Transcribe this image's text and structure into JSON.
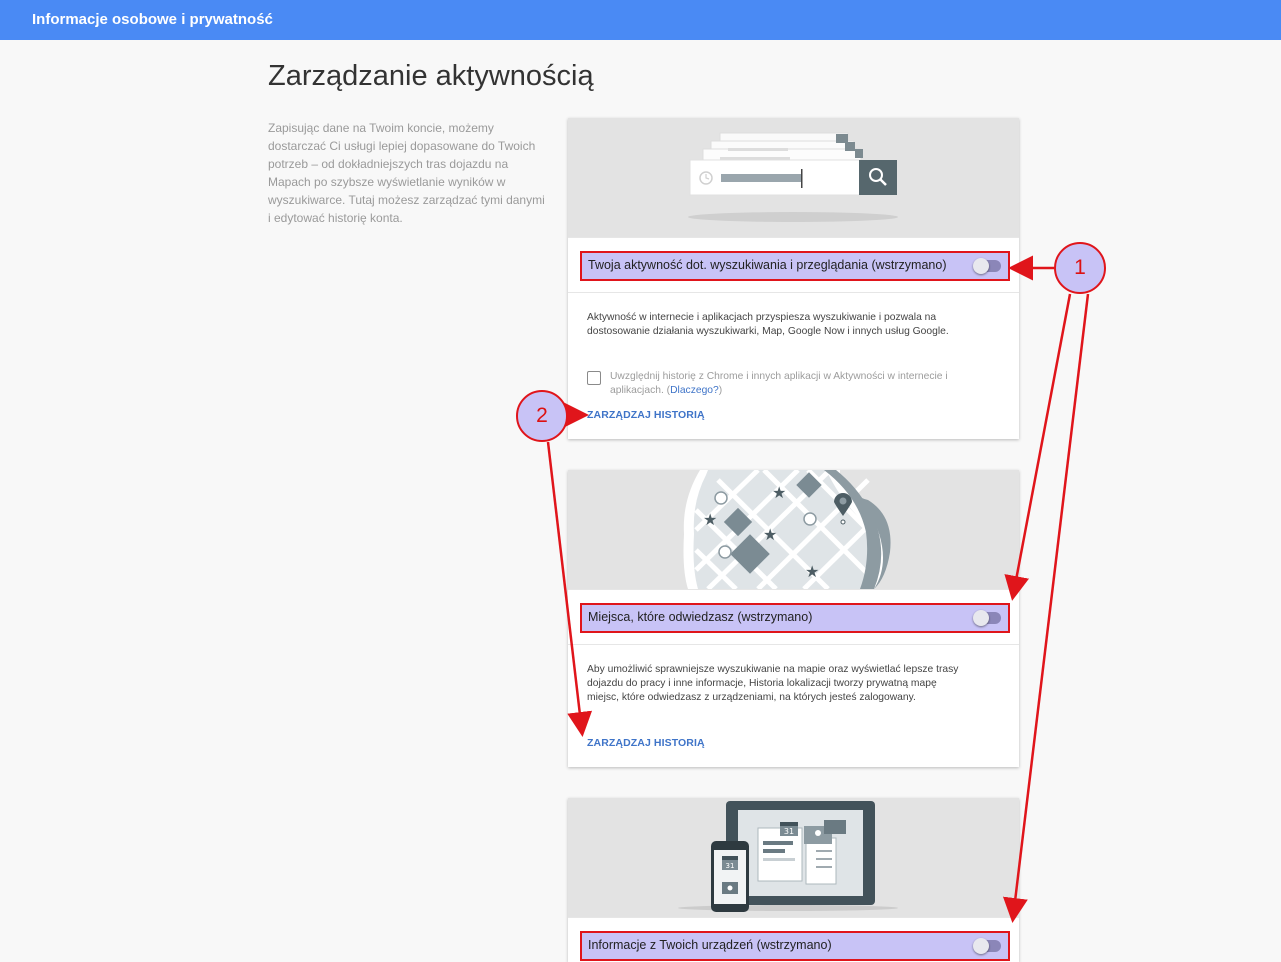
{
  "header": {
    "title": "Informacje osobowe i prywatność"
  },
  "page": {
    "title": "Zarządzanie aktywnością",
    "intro": "Zapisując dane na Twoim koncie, możemy dostarczać Ci usługi lepiej dopasowane do Twoich potrzeb – od dokładniejszych tras dojazdu na Mapach po szybsze wyświetlanie wyników w wyszukiwarce. Tutaj możesz zarządzać tymi danymi i edytować historię konta."
  },
  "cards": [
    {
      "title": "Twoja aktywność dot. wyszukiwania i przeglądania (wstrzymano)",
      "toggle_on": false,
      "description": "Aktywność w internecie i aplikacjach przyspiesza wyszukiwanie i pozwala na dostosowanie działania wyszukiwarki, Map, Google Now i innych usług Google.",
      "checkbox_label": "Uwzględnij historię z Chrome i innych aplikacji w Aktywności w internecie i aplikacjach. (",
      "checkbox_link": "Dlaczego?",
      "checkbox_label_end": ")",
      "manage_label": "ZARZĄDZAJ HISTORIĄ"
    },
    {
      "title": "Miejsca, które odwiedzasz (wstrzymano)",
      "toggle_on": false,
      "description": "Aby umożliwić sprawniejsze wyszukiwanie na mapie oraz wyświetlać lepsze trasy dojazdu do pracy i inne informacje, Historia lokalizacji tworzy prywatną mapę miejsc, które odwiedzasz z urządzeniami, na których jesteś zalogowany.",
      "manage_label": "ZARZĄDZAJ HISTORIĄ"
    },
    {
      "title": "Informacje z Twoich urządzeń (wstrzymano)",
      "toggle_on": false,
      "calendar_day": "31"
    }
  ],
  "callouts": [
    "1",
    "2"
  ],
  "colors": {
    "topbar": "#4a8af4",
    "highlight": "#c8c3f6",
    "annotation": "#e0151b",
    "link": "#3f74c8"
  }
}
